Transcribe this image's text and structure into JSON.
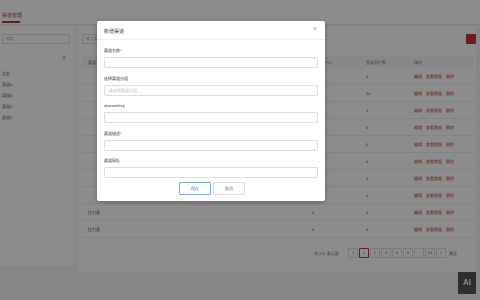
{
  "top_tab": {
    "label": "渠道管理"
  },
  "sidebar": {
    "search_placeholder": "搜索",
    "plus": "+",
    "items": [
      "全部",
      "渠道A",
      "渠道B",
      "渠道C",
      "渠道D"
    ]
  },
  "main": {
    "search_placeholder": "输入渠道名称",
    "add_label": "新增",
    "headers": [
      "渠道名称",
      "访问量(PV)",
      "登录用户数",
      "操作"
    ],
    "rows": [
      {
        "name": "",
        "pv": "0",
        "users": "0"
      },
      {
        "name": "",
        "pv": "0",
        "users": "24"
      },
      {
        "name": "",
        "pv": "0",
        "users": "1"
      },
      {
        "name": "",
        "pv": "0",
        "users": "0"
      },
      {
        "name": "",
        "pv": "0",
        "users": "0"
      },
      {
        "name": "",
        "pv": "0",
        "users": "0"
      },
      {
        "name": "",
        "pv": "0",
        "users": "0"
      },
      {
        "name": "",
        "pv": "0",
        "users": "0"
      },
      {
        "name": "拉力赛",
        "pv": "0",
        "users": "0"
      },
      {
        "name": "拉力赛",
        "pv": "0",
        "users": "0"
      }
    ],
    "ops": [
      "编辑",
      "查看数据",
      "删除"
    ]
  },
  "pager": {
    "total": "共 231 条记录",
    "pages": [
      "1",
      "2",
      "3",
      "4",
      "5",
      "24"
    ],
    "ellipsis": "…",
    "prev": "<",
    "next": ">",
    "goto": "跳至"
  },
  "modal": {
    "title": "新增渠道",
    "close": "×",
    "fields": [
      {
        "label": "渠道名称",
        "required": true,
        "placeholder": ""
      },
      {
        "label": "选择渠道分组",
        "required": false,
        "placeholder": "请选择渠道分组"
      },
      {
        "label": "channelKey",
        "required": false,
        "placeholder": ""
      },
      {
        "label": "渠道描述",
        "required": true,
        "placeholder": ""
      },
      {
        "label": "渠道网址",
        "required": false,
        "placeholder": ""
      }
    ],
    "save": "保存",
    "cancel": "取消"
  },
  "logo": "AI"
}
